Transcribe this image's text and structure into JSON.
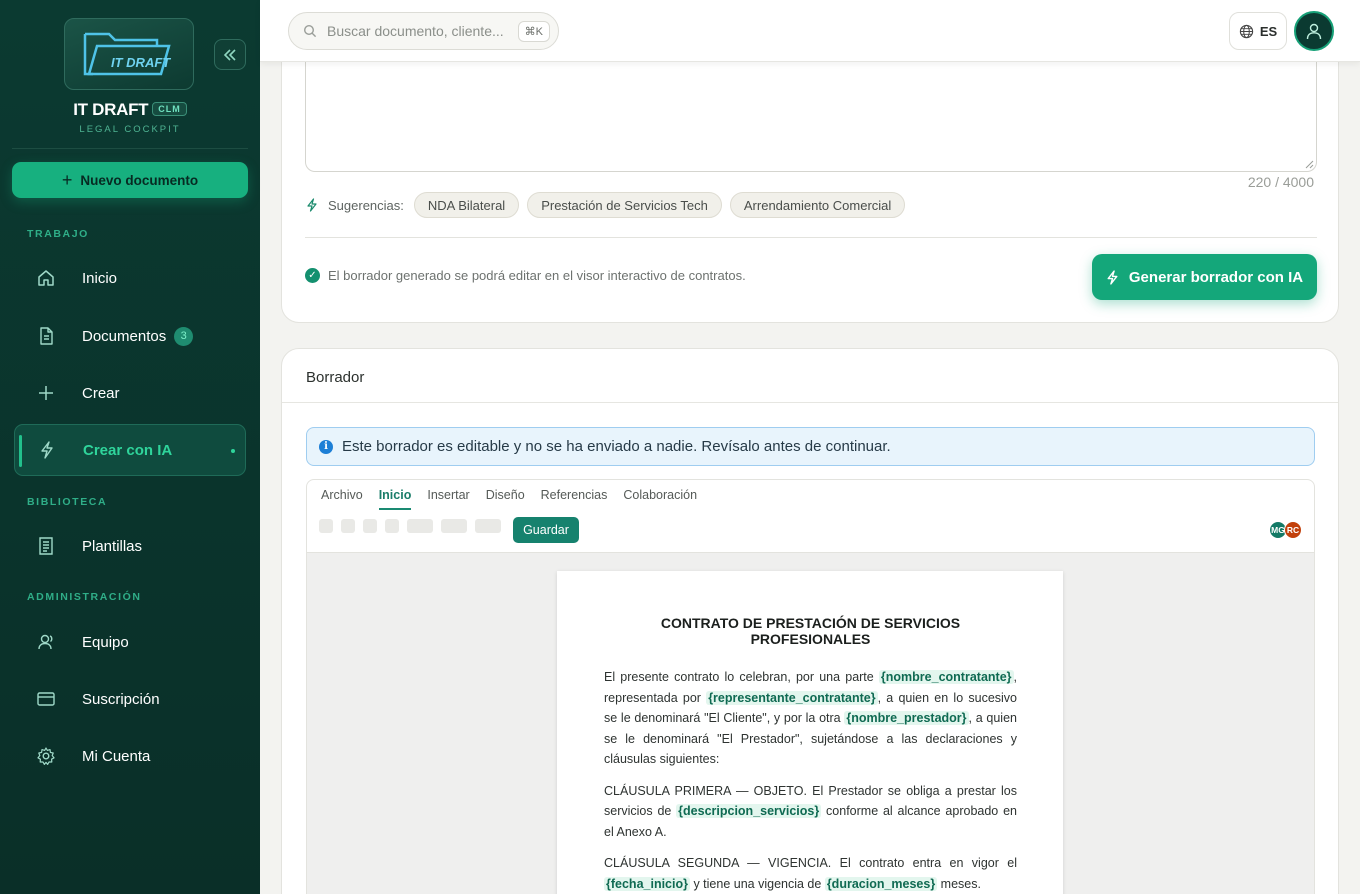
{
  "sidebar": {
    "brand": {
      "name": "IT DRAFT",
      "tag": "CLM",
      "subtitle": "LEGAL COCKPIT",
      "logo_text": "IT DRAFT"
    },
    "new_document": "Nuevo documento",
    "sections": [
      {
        "label": "TRABAJO",
        "items": [
          {
            "label": "Inicio",
            "icon": "home-icon"
          },
          {
            "label": "Documentos",
            "icon": "document-icon",
            "badge": "3"
          },
          {
            "label": "Crear",
            "icon": "plus-icon"
          },
          {
            "label": "Crear con IA",
            "icon": "bolt-icon",
            "active": true
          }
        ]
      },
      {
        "label": "BIBLIOTECA",
        "items": [
          {
            "label": "Plantillas",
            "icon": "templates-icon"
          }
        ]
      },
      {
        "label": "ADMINISTRACIÓN",
        "items": [
          {
            "label": "Equipo",
            "icon": "team-icon"
          },
          {
            "label": "Suscripción",
            "icon": "card-icon"
          },
          {
            "label": "Mi Cuenta",
            "icon": "gear-icon"
          }
        ]
      }
    ]
  },
  "topbar": {
    "search_placeholder": "Buscar documento, cliente...",
    "search_shortcut": "⌘K",
    "language": "ES"
  },
  "generator": {
    "char_count": "220 / 4000",
    "suggestions_label": "Sugerencias:",
    "suggestions": [
      "NDA Bilateral",
      "Prestación de Servicios Tech",
      "Arrendamiento Comercial"
    ],
    "note": "El borrador generado se podrá editar en el visor interactivo de contratos.",
    "generate_button": "Generar borrador con IA"
  },
  "draft": {
    "title": "Borrador",
    "info": "Este borrador es editable y no se ha enviado a nadie. Revísalo antes de continuar.",
    "menu": [
      "Archivo",
      "Inicio",
      "Insertar",
      "Diseño",
      "Referencias",
      "Colaboración"
    ],
    "active_menu": "Inicio",
    "save_button": "Guardar",
    "collaborators": [
      {
        "initials": "MG",
        "color": "#137a66"
      },
      {
        "initials": "RC",
        "color": "#c2410c"
      }
    ],
    "document": {
      "title": "CONTRATO DE PRESTACIÓN DE SERVICIOS PROFESIONALES",
      "p1": {
        "a": "El presente contrato lo celebran, por una parte ",
        "v1": "{nombre_contratante}",
        "b": ", representada por ",
        "v2": "{representante_contratante}",
        "c": ", a quien en lo sucesivo se le denominará \"El Cliente\", y por la otra ",
        "v3": "{nombre_prestador}",
        "d": ", a quien se le denominará \"El Prestador\", sujetándose a las declaraciones y cláusulas siguientes:"
      },
      "p2": {
        "a": "CLÁUSULA PRIMERA — OBJETO. El Prestador se obliga a prestar los servicios de ",
        "v1": "{descripcion_servicios}",
        "b": " conforme al alcance aprobado en el Anexo A."
      },
      "p3": {
        "a": "CLÁUSULA SEGUNDA — VIGENCIA. El contrato entra en vigor el ",
        "v1": "{fecha_inicio}",
        "b": " y tiene una vigencia de ",
        "v2": "{duracion_meses}",
        "c": " meses."
      }
    }
  }
}
